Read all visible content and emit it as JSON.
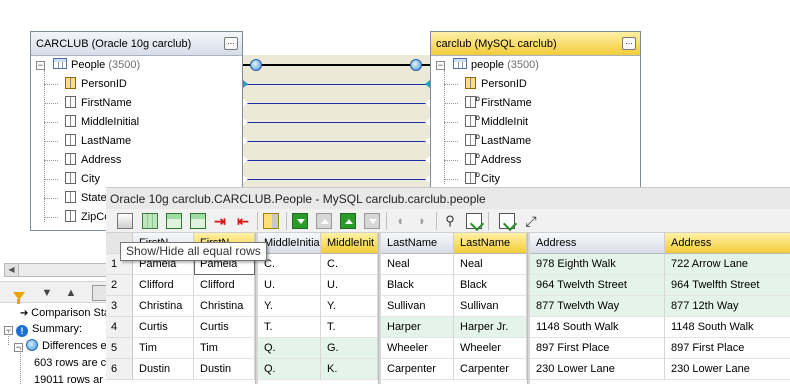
{
  "left_db": {
    "title": "CARCLUB (Oracle 10g carclub)",
    "table": "People",
    "count": "(3500)",
    "columns": [
      "PersonID",
      "FirstName",
      "MiddleInitial",
      "LastName",
      "Address",
      "City",
      "State",
      "ZipCo"
    ]
  },
  "right_db": {
    "title": "carclub (MySQL carclub)",
    "table": "people",
    "count": "(3500)",
    "columns": [
      "PersonID",
      "FirstName",
      "MiddleInit",
      "LastName",
      "Address",
      "City"
    ]
  },
  "dots_label": "...",
  "tree_expander": "−",
  "left_panel": {
    "items": [
      {
        "text": "Comparison Sta"
      },
      {
        "text": "Summary:"
      },
      {
        "text": "Differences e"
      },
      {
        "text": "603 rows are c"
      },
      {
        "text": "19011 rows ar"
      }
    ]
  },
  "compare": {
    "title": "Oracle 10g carclub.CARCLUB.People - MySQL carclub.carclub.people",
    "tooltip": "Show/Hide all equal rows",
    "headers": [
      {
        "text": "FirstN",
        "side": "l"
      },
      {
        "text": "FirstN",
        "side": "r"
      },
      {
        "text": "MiddleInitial",
        "side": "l"
      },
      {
        "text": "MiddleInit",
        "side": "r"
      },
      {
        "text": "LastName",
        "side": "l"
      },
      {
        "text": "LastName",
        "side": "r"
      },
      {
        "text": "Address",
        "side": "l"
      },
      {
        "text": "Address",
        "side": "r"
      }
    ],
    "rows": [
      {
        "num": "1",
        "cells": [
          "Pamela",
          "Pamela",
          "C.",
          "C.",
          "Neal",
          "Neal",
          "978 Eighth Walk",
          "722 Arrow Lane"
        ],
        "diff": [
          6,
          7
        ]
      },
      {
        "num": "2",
        "cells": [
          "Clifford",
          "Clifford",
          "U.",
          "U.",
          "Black",
          "Black",
          "964 Twelvth Street",
          "964 Twelfth Street"
        ],
        "diff": [
          6,
          7
        ]
      },
      {
        "num": "3",
        "cells": [
          "Christina",
          "Christina",
          "Y.",
          "Y.",
          "Sullivan",
          "Sullivan",
          "877 Twelvth Way",
          "877 12th Way"
        ],
        "diff": [
          6,
          7
        ]
      },
      {
        "num": "4",
        "cells": [
          "Curtis",
          "Curtis",
          "T.",
          "T.",
          "Harper",
          "Harper Jr.",
          "1148 South Walk",
          "1148 South Walk"
        ],
        "diff": [
          4,
          5
        ]
      },
      {
        "num": "5",
        "cells": [
          "Tim",
          "Tim",
          "Q.",
          "G.",
          "Wheeler",
          "Wheeler",
          "897 First Place",
          "897 First Place"
        ],
        "diff": [
          2,
          3
        ]
      },
      {
        "num": "6",
        "cells": [
          "Dustin",
          "Dustin",
          "Q.",
          "K.",
          "Carpenter",
          "Carpenter",
          "230 Lower Lane",
          "230 Lower Lane"
        ],
        "diff": [
          2,
          3
        ]
      }
    ]
  }
}
